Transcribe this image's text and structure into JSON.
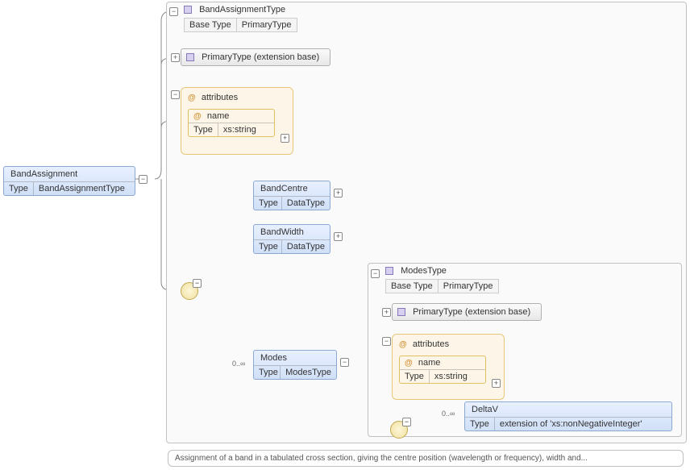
{
  "root": {
    "name": "BandAssignment",
    "type_label": "Type",
    "type_value": "BandAssignmentType"
  },
  "main_type": {
    "name": "BandAssignmentType",
    "base_label": "Base Type",
    "base_value": "PrimaryType"
  },
  "primary_ext": "PrimaryType (extension base)",
  "attr_group": {
    "label": "attributes",
    "attr_name": "name",
    "attr_type_label": "Type",
    "attr_type_value": "xs:string"
  },
  "band_centre": {
    "name": "BandCentre",
    "type_label": "Type",
    "type_value": "DataType"
  },
  "band_width": {
    "name": "BandWidth",
    "type_label": "Type",
    "type_value": "DataType"
  },
  "modes": {
    "name": "Modes",
    "type_label": "Type",
    "type_value": "ModesType",
    "occurrence": "0..∞"
  },
  "modes_type": {
    "name": "ModesType",
    "base_label": "Base Type",
    "base_value": "PrimaryType"
  },
  "modes_primary_ext": "PrimaryType (extension base)",
  "modes_attr_group": {
    "label": "attributes",
    "attr_name": "name",
    "attr_type_label": "Type",
    "attr_type_value": "xs:string"
  },
  "deltav": {
    "name": "DeltaV",
    "type_label": "Type",
    "type_value": "extension of 'xs:nonNegativeInteger'",
    "occurrence": "0..∞"
  },
  "footer": "Assignment of a band in a tabulated cross section, giving the centre position (wavelength or frequency), width and..."
}
